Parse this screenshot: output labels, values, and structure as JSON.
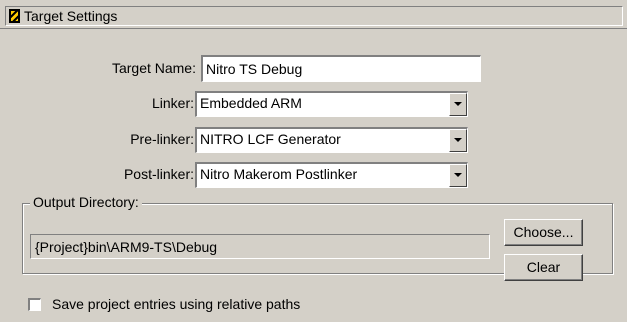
{
  "header": {
    "title": "Target Settings",
    "icon": "target-settings-icon"
  },
  "fields": {
    "target_name": {
      "label": "Target Name:",
      "value": "Nitro TS Debug"
    },
    "linker": {
      "label": "Linker:",
      "value": "Embedded ARM"
    },
    "prelinker": {
      "label": "Pre-linker:",
      "value": "NITRO LCF Generator"
    },
    "postlinker": {
      "label": "Post-linker:",
      "value": "Nitro Makerom Postlinker"
    }
  },
  "output": {
    "group_title": "Output Directory:",
    "path": "{Project}bin\\ARM9-TS\\Debug",
    "choose_label": "Choose...",
    "clear_label": "Clear"
  },
  "options": {
    "relative_paths_label": "Save project entries using relative paths",
    "relative_paths_checked": false
  }
}
